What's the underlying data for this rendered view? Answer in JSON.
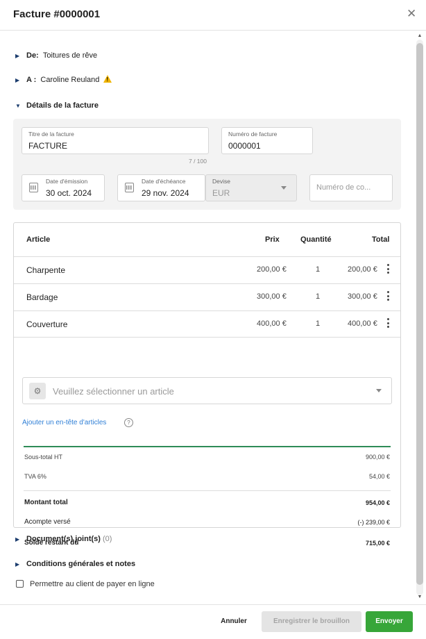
{
  "modal": {
    "title": "Facture #0000001"
  },
  "sections": {
    "from_label": "De:",
    "from_value": "Toitures de rêve",
    "to_label": "A :",
    "to_value": "Caroline Reuland",
    "details_label": "Détails de la facture",
    "documents_label": "Document(s) joint(s)",
    "documents_count": "(0)",
    "conditions_label": "Conditions générales et notes"
  },
  "details": {
    "title_label": "Titre de la facture",
    "title_value": "FACTURE",
    "title_counter": "7 / 100",
    "number_label": "Numéro de facture",
    "number_value": "0000001",
    "issue_label": "Date d'émission",
    "issue_value": "30 oct. 2024",
    "due_label": "Date d'échéance",
    "due_value": "29 nov. 2024",
    "currency_label": "Devise",
    "currency_value": "EUR",
    "extra_placeholder": "Numéro de co..."
  },
  "table": {
    "headers": {
      "article": "Article",
      "price": "Prix",
      "qty": "Quantité",
      "total": "Total"
    },
    "rows": [
      {
        "name": "Charpente",
        "price": "200,00 €",
        "qty": "1",
        "total": "200,00 €"
      },
      {
        "name": "Bardage",
        "price": "300,00 €",
        "qty": "1",
        "total": "300,00 €"
      },
      {
        "name": "Couverture",
        "price": "400,00 €",
        "qty": "1",
        "total": "400,00 €"
      }
    ],
    "select_placeholder": "Veuillez sélectionner un article",
    "add_header_link": "Ajouter un en-tête d'articles"
  },
  "summary": {
    "subtotal_label": "Sous-total HT",
    "subtotal_value": "900,00 €",
    "vat_label": "TVA 6%",
    "vat_value": "54,00 €",
    "total_label": "Montant total",
    "total_value": "954,00 €",
    "deposit_label": "Acompte versé",
    "deposit_value": "(-) 239,00 €",
    "balance_label": "Solde restant dû",
    "balance_value": "715,00 €"
  },
  "online_payment": {
    "label": "Permettre au client de payer en ligne",
    "checked": false
  },
  "footer": {
    "cancel": "Annuler",
    "draft": "Enregistrer le brouillon",
    "send": "Envoyer"
  },
  "colors": {
    "send": "#37a639",
    "link": "#2f7fd6",
    "warning": "#f0b400",
    "divider": "#2e8b57"
  }
}
